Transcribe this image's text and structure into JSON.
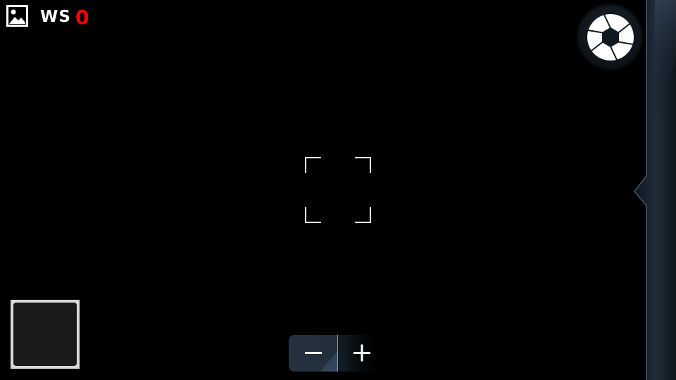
{
  "status": {
    "mode_label": "WS",
    "shot_count": "0",
    "shot_count_color": "#ff0000"
  },
  "icons": {
    "gallery": "gallery-image-icon",
    "shutter": "aperture-icon",
    "zoom_out": "minus-icon",
    "zoom_in": "plus-icon",
    "focus": "focus-bracket-icon"
  },
  "colors": {
    "background": "#000000",
    "panel": "#1c2834",
    "thumbnail_border": "#d8d8d8"
  }
}
